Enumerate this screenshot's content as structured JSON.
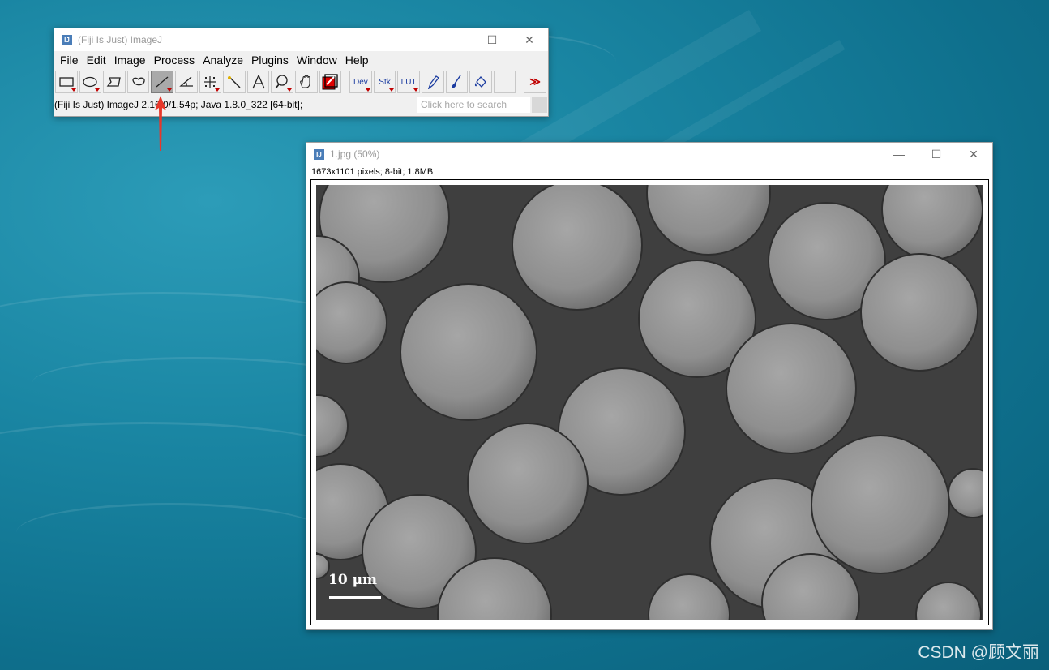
{
  "main_window": {
    "title": "(Fiji Is Just) ImageJ",
    "icon_text": "IJ",
    "menus": [
      "File",
      "Edit",
      "Image",
      "Process",
      "Analyze",
      "Plugins",
      "Window",
      "Help"
    ],
    "tools": [
      {
        "name": "rectangle-tool",
        "icon": "rectangle-icon",
        "dropdown": true
      },
      {
        "name": "oval-tool",
        "icon": "oval-icon",
        "dropdown": true
      },
      {
        "name": "polygon-tool",
        "icon": "polygon-icon",
        "dropdown": false
      },
      {
        "name": "freehand-tool",
        "icon": "freehand-icon",
        "dropdown": false
      },
      {
        "name": "line-tool",
        "icon": "line-icon",
        "dropdown": true,
        "selected": true
      },
      {
        "name": "angle-tool",
        "icon": "angle-icon",
        "dropdown": false
      },
      {
        "name": "point-tool",
        "icon": "point-icon",
        "dropdown": true
      },
      {
        "name": "wand-tool",
        "icon": "wand-icon",
        "dropdown": false
      },
      {
        "name": "text-tool",
        "icon": "text-icon",
        "dropdown": false
      },
      {
        "name": "zoom-tool",
        "icon": "magnifier-icon",
        "dropdown": true
      },
      {
        "name": "scroll-tool",
        "icon": "hand-icon",
        "dropdown": false
      },
      {
        "name": "color-picker-tool",
        "icon": "color-picker-icon",
        "dropdown": false
      }
    ],
    "extra_tools": [
      {
        "name": "dev-menu",
        "label": "Dev"
      },
      {
        "name": "stk-menu",
        "label": "Stk"
      },
      {
        "name": "lut-menu",
        "label": "LUT"
      }
    ],
    "extra_icons": [
      "pencil-icon",
      "brush-icon",
      "flood-fill-icon"
    ],
    "more_tools_label": "≫",
    "status": "(Fiji Is Just) ImageJ 2.16.0/1.54p; Java 1.8.0_322 [64-bit];",
    "search_placeholder": "Click here to search"
  },
  "image_window": {
    "title": "1.jpg (50%)",
    "icon_text": "IJ",
    "info": "1673x1101 pixels; 8-bit; 1.8MB",
    "scale_bar_label": "10 μm"
  },
  "window_controls": {
    "minimize": "—",
    "maximize": "☐",
    "close": "✕"
  },
  "watermark": "CSDN @顾文丽",
  "colors": {
    "selected_tool": "#a9a9a9",
    "dropdown_marker": "#c00000",
    "annotation_arrow": "#e8372a",
    "sem_background": "#3f3f3f"
  }
}
